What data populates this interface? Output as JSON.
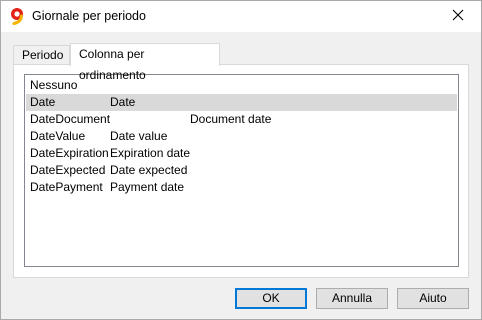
{
  "window": {
    "title": "Giornale per periodo",
    "icon": "banana-app-icon",
    "close_icon": "close-icon"
  },
  "tabs": [
    {
      "label": "Periodo",
      "active": false
    },
    {
      "label": "Colonna per ordinamento",
      "active": true
    }
  ],
  "list": {
    "rows": [
      {
        "name": "Nessuno",
        "header": "",
        "description": "",
        "selected": false
      },
      {
        "name": "Date",
        "header": "Date",
        "description": "",
        "selected": true
      },
      {
        "name": "DateDocument",
        "header": "",
        "description": "Document date",
        "selected": false
      },
      {
        "name": "DateValue",
        "header": "Date value",
        "description": "",
        "selected": false
      },
      {
        "name": "DateExpiration",
        "header": "Expiration date",
        "description": "",
        "selected": false
      },
      {
        "name": "DateExpected",
        "header": "Date expected",
        "description": "",
        "selected": false
      },
      {
        "name": "DatePayment",
        "header": "Payment date",
        "description": "",
        "selected": false
      }
    ]
  },
  "buttons": {
    "ok": "OK",
    "cancel": "Annulla",
    "help": "Aiuto"
  },
  "colors": {
    "selection": "#d9d9d9",
    "default_button_border": "#0078d7",
    "icon_red": "#e2231a",
    "icon_yellow": "#f5b400"
  }
}
